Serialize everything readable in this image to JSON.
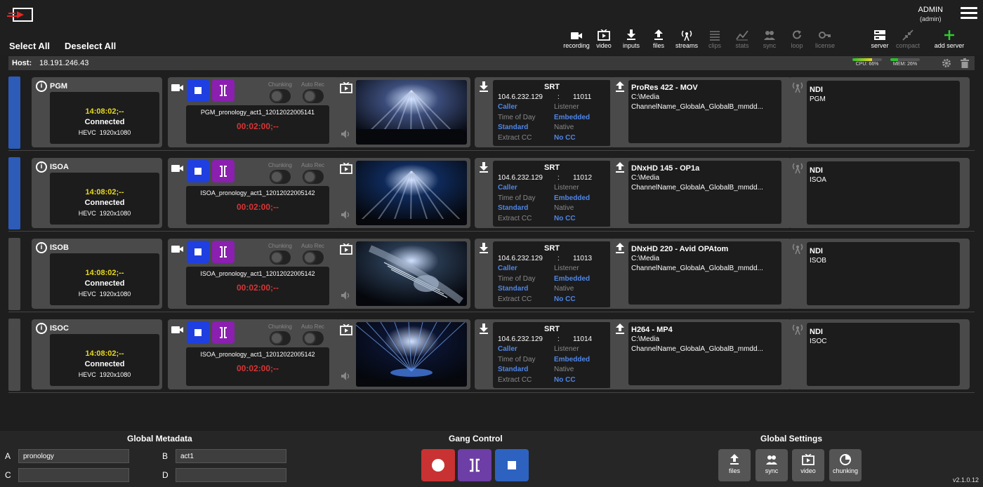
{
  "user": {
    "name": "ADMIN",
    "role": "(admin)"
  },
  "select_all": "Select All",
  "deselect_all": "Deselect All",
  "toolbar": [
    {
      "label": "recording",
      "icon": "camera-icon",
      "enabled": true
    },
    {
      "label": "video",
      "icon": "tv-icon",
      "enabled": true
    },
    {
      "label": "inputs",
      "icon": "download-icon",
      "enabled": true
    },
    {
      "label": "files",
      "icon": "upload-icon",
      "enabled": true
    },
    {
      "label": "streams",
      "icon": "antenna-icon",
      "enabled": true
    },
    {
      "label": "clips",
      "icon": "list-icon",
      "enabled": false
    },
    {
      "label": "stats",
      "icon": "chart-icon",
      "enabled": false
    },
    {
      "label": "sync",
      "icon": "sync-icon",
      "enabled": false
    },
    {
      "label": "loop",
      "icon": "loop-icon",
      "enabled": false
    },
    {
      "label": "license",
      "icon": "key-icon",
      "enabled": false
    },
    {
      "label": "server",
      "icon": "server-icon",
      "enabled": true
    },
    {
      "label": "compact",
      "icon": "compact-icon",
      "enabled": false
    },
    {
      "label": "add server",
      "icon": "plus-icon",
      "enabled": true
    }
  ],
  "host": {
    "label": "Host:",
    "value": "18.191.246.43"
  },
  "meters": {
    "cpu_label": "CPU: 66%",
    "cpu": 0.66,
    "mem_label": "MEM: 26%",
    "mem": 0.26
  },
  "channels": [
    {
      "name": "PGM",
      "selected": true,
      "time": "14:08:02;--",
      "status": "Connected",
      "codec": "HEVC",
      "resolution": "1920x1080",
      "chunking_label": "Chunking",
      "autorec_label": "Auto Rec",
      "filename": "PGM_pronology_act1_12012022005141",
      "rec_time": "00:02:00;--",
      "srt": {
        "title": "SRT",
        "ip": "104.6.232.129",
        "sep": ":",
        "port": "11011",
        "mode_a": "Caller",
        "mode_b": "Listener",
        "tc_label": "Time of Day",
        "tc_val": "Embedded",
        "std_a": "Standard",
        "std_b": "Native",
        "cc_label": "Extract CC",
        "cc_val": "No CC"
      },
      "output": {
        "format": "ProRes 422 - MOV",
        "path": "C:\\Media",
        "name": "ChannelName_GlobalA_GlobalB_mmdd..."
      },
      "stream": {
        "type": "NDI",
        "name": "PGM"
      }
    },
    {
      "name": "ISOA",
      "selected": true,
      "time": "14:08:02;--",
      "status": "Connected",
      "codec": "HEVC",
      "resolution": "1920x1080",
      "chunking_label": "Chunking",
      "autorec_label": "Auto Rec",
      "filename": "ISOA_pronology_act1_12012022005142",
      "rec_time": "00:02:00;--",
      "srt": {
        "title": "SRT",
        "ip": "104.6.232.129",
        "sep": ":",
        "port": "11012",
        "mode_a": "Caller",
        "mode_b": "Listener",
        "tc_label": "Time of Day",
        "tc_val": "Embedded",
        "std_a": "Standard",
        "std_b": "Native",
        "cc_label": "Extract CC",
        "cc_val": "No CC"
      },
      "output": {
        "format": "DNxHD 145 - OP1a",
        "path": "C:\\Media",
        "name": "ChannelName_GlobalA_GlobalB_mmdd..."
      },
      "stream": {
        "type": "NDI",
        "name": "ISOA"
      }
    },
    {
      "name": "ISOB",
      "selected": false,
      "time": "14:08:02;--",
      "status": "Connected",
      "codec": "HEVC",
      "resolution": "1920x1080",
      "chunking_label": "Chunking",
      "autorec_label": "Auto Rec",
      "filename": "ISOA_pronology_act1_12012022005142",
      "rec_time": "00:02:00;--",
      "srt": {
        "title": "SRT",
        "ip": "104.6.232.129",
        "sep": ":",
        "port": "11013",
        "mode_a": "Caller",
        "mode_b": "Listener",
        "tc_label": "Time of Day",
        "tc_val": "Embedded",
        "std_a": "Standard",
        "std_b": "Native",
        "cc_label": "Extract CC",
        "cc_val": "No CC"
      },
      "output": {
        "format": "DNxHD 220 - Avid OPAtom",
        "path": "C:\\Media",
        "name": "ChannelName_GlobalA_GlobalB_mmdd..."
      },
      "stream": {
        "type": "NDI",
        "name": "ISOB"
      }
    },
    {
      "name": "ISOC",
      "selected": false,
      "time": "14:08:02;--",
      "status": "Connected",
      "codec": "HEVC",
      "resolution": "1920x1080",
      "chunking_label": "Chunking",
      "autorec_label": "Auto Rec",
      "filename": "ISOA_pronology_act1_12012022005142",
      "rec_time": "00:02:00;--",
      "srt": {
        "title": "SRT",
        "ip": "104.6.232.129",
        "sep": ":",
        "port": "11014",
        "mode_a": "Caller",
        "mode_b": "Listener",
        "tc_label": "Time of Day",
        "tc_val": "Embedded",
        "std_a": "Standard",
        "std_b": "Native",
        "cc_label": "Extract CC",
        "cc_val": "No CC"
      },
      "output": {
        "format": "H264 - MP4",
        "path": "C:\\Media",
        "name": "ChannelName_GlobalA_GlobalB_mmdd..."
      },
      "stream": {
        "type": "NDI",
        "name": "ISOC"
      }
    }
  ],
  "footer": {
    "metadata_title": "Global Metadata",
    "fields": {
      "A": "pronology",
      "B": "act1",
      "C": "",
      "D": ""
    },
    "labels": {
      "A": "A",
      "B": "B",
      "C": "C",
      "D": "D"
    },
    "gang_title": "Gang Control",
    "settings_title": "Global Settings",
    "settings": [
      "files",
      "sync",
      "video",
      "chunking"
    ],
    "version": "v2.1.0.12"
  },
  "colors": {
    "selected": "#2c5bb8",
    "unselected": "#4a4a4a",
    "stop": "#1f3fe0",
    "split": "#8a1fb0",
    "rec": "#c93232",
    "gang_split": "#6d3ea6",
    "gang_stop": "#2e62c0"
  }
}
